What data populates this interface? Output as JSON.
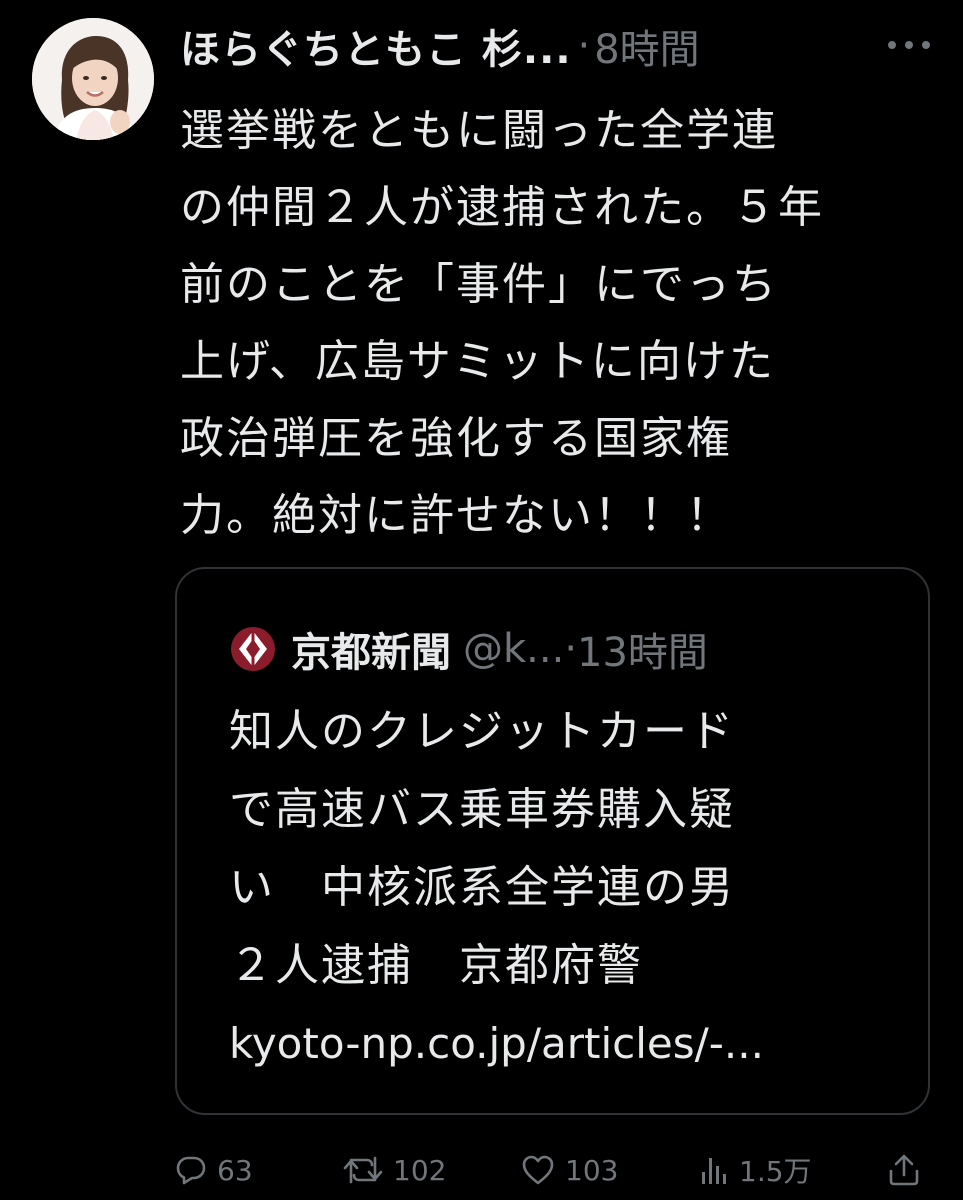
{
  "post": {
    "author_name": "ほらぐちともこ 杉...",
    "separator": "·",
    "time": "8時間",
    "text": "選挙戦をともに闘った全学連\nの仲間２人が逮捕された。５年\n前のことを「事件」にでっち\n上げ、広島サミットに向けた\n政治弾圧を強化する国家権\n力。絶対に許せない！！！"
  },
  "quote": {
    "name": "京都新聞",
    "handle": "@k...",
    "separator": "·",
    "time": "13時間",
    "text": "知人のクレジットカード\nで高速バス乗車券購入疑\nい　中核派系全学連の男\n２人逮捕　京都府警",
    "link": "kyoto-np.co.jp/articles/-..."
  },
  "actions": {
    "reply_count": "63",
    "retweet_count": "102",
    "like_count": "103",
    "view_count": "1.5万"
  },
  "icons": {
    "more": "more-icon",
    "reply": "reply-icon",
    "retweet": "retweet-icon",
    "like": "heart-icon",
    "views": "views-icon",
    "share": "share-icon"
  },
  "colors": {
    "background": "#000000",
    "text_primary": "#e7e9ea",
    "text_secondary": "#71767b",
    "border": "#2f3336",
    "kyoto_logo": "#8b1c2c"
  }
}
